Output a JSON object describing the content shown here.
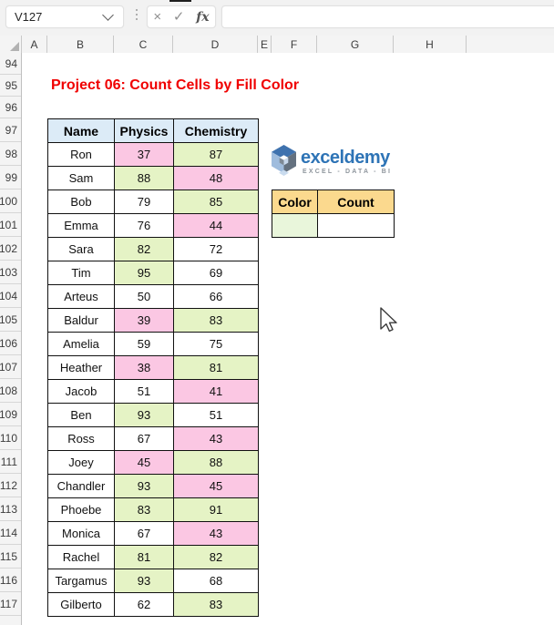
{
  "topbar": {
    "name_box_value": "V127",
    "cancel_label": "×",
    "enter_label": "✓",
    "fx_label": "fx",
    "formula_value": ""
  },
  "grid": {
    "column_labels": [
      "A",
      "B",
      "C",
      "D",
      "E",
      "F",
      "G",
      "H"
    ],
    "row_labels": [
      94,
      95,
      96,
      97,
      98,
      99,
      100,
      101,
      102,
      103,
      104,
      105,
      106,
      107,
      108,
      109,
      110,
      111,
      112,
      113,
      114,
      115,
      116,
      117
    ]
  },
  "sheet": {
    "title": "Project 06: Count Cells by Fill Color",
    "score_table": {
      "headers": [
        "Name",
        "Physics",
        "Chemistry"
      ],
      "rows": [
        {
          "name": "Ron",
          "physics": "37",
          "physics_fill": "pink",
          "chemistry": "87",
          "chemistry_fill": "green"
        },
        {
          "name": "Sam",
          "physics": "88",
          "physics_fill": "green",
          "chemistry": "48",
          "chemistry_fill": "pink"
        },
        {
          "name": "Bob",
          "physics": "79",
          "physics_fill": "none",
          "chemistry": "85",
          "chemistry_fill": "green"
        },
        {
          "name": "Emma",
          "physics": "76",
          "physics_fill": "none",
          "chemistry": "44",
          "chemistry_fill": "pink"
        },
        {
          "name": "Sara",
          "physics": "82",
          "physics_fill": "green",
          "chemistry": "72",
          "chemistry_fill": "none"
        },
        {
          "name": "Tim",
          "physics": "95",
          "physics_fill": "green",
          "chemistry": "69",
          "chemistry_fill": "none"
        },
        {
          "name": "Arteus",
          "physics": "50",
          "physics_fill": "none",
          "chemistry": "66",
          "chemistry_fill": "none"
        },
        {
          "name": "Baldur",
          "physics": "39",
          "physics_fill": "pink",
          "chemistry": "83",
          "chemistry_fill": "green"
        },
        {
          "name": "Amelia",
          "physics": "59",
          "physics_fill": "none",
          "chemistry": "75",
          "chemistry_fill": "none"
        },
        {
          "name": "Heather",
          "physics": "38",
          "physics_fill": "pink",
          "chemistry": "81",
          "chemistry_fill": "green"
        },
        {
          "name": "Jacob",
          "physics": "51",
          "physics_fill": "none",
          "chemistry": "41",
          "chemistry_fill": "pink"
        },
        {
          "name": "Ben",
          "physics": "93",
          "physics_fill": "green",
          "chemistry": "51",
          "chemistry_fill": "none"
        },
        {
          "name": "Ross",
          "physics": "67",
          "physics_fill": "none",
          "chemistry": "43",
          "chemistry_fill": "pink"
        },
        {
          "name": "Joey",
          "physics": "45",
          "physics_fill": "pink",
          "chemistry": "88",
          "chemistry_fill": "green"
        },
        {
          "name": "Chandler",
          "physics": "93",
          "physics_fill": "green",
          "chemistry": "45",
          "chemistry_fill": "pink"
        },
        {
          "name": "Phoebe",
          "physics": "83",
          "physics_fill": "green",
          "chemistry": "91",
          "chemistry_fill": "green"
        },
        {
          "name": "Monica",
          "physics": "67",
          "physics_fill": "none",
          "chemistry": "43",
          "chemistry_fill": "pink"
        },
        {
          "name": "Rachel",
          "physics": "81",
          "physics_fill": "green",
          "chemistry": "82",
          "chemistry_fill": "green"
        },
        {
          "name": "Targamus",
          "physics": "93",
          "physics_fill": "green",
          "chemistry": "68",
          "chemistry_fill": "none"
        },
        {
          "name": "Gilberto",
          "physics": "62",
          "physics_fill": "none",
          "chemistry": "83",
          "chemistry_fill": "green"
        }
      ]
    },
    "logo": {
      "brand": "exceldemy",
      "tagline": "EXCEL - DATA - BI"
    },
    "count_table": {
      "color_header": "Color",
      "count_header": "Count",
      "count_value": "",
      "swatch_fill": "swatch_green"
    }
  },
  "colors": {
    "pink": "#FBC7E3",
    "green": "#E5F3C5",
    "none": "#FFFFFF",
    "header_blue": "#DCEBF7",
    "count_header_orange": "#FBD98E",
    "swatch_green": "#E9F6DB",
    "title_red": "#F00000",
    "brand_blue": "#2E74B6"
  }
}
